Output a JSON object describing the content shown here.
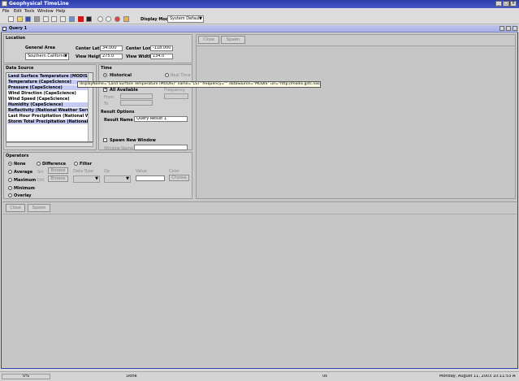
{
  "window": {
    "title": "Geophysical TimeLine",
    "minimize": "_",
    "maximize": "□",
    "close": "X"
  },
  "menu": [
    "File",
    "Edit",
    "Tools",
    "Window",
    "Help"
  ],
  "toolbar": {
    "display_mode_label": "Display Mode",
    "display_mode_value": "System Default"
  },
  "frame": {
    "title": "Query 1"
  },
  "location": {
    "title": "Location",
    "general_area_label": "General Area",
    "general_area_value": "Southern California",
    "center_lat_label": "Center Lat",
    "center_lat_value": "34.000",
    "center_long_label": "Center Long",
    "center_long_value": "-118.000",
    "view_height_label": "View Height",
    "view_height_value": "275.0",
    "view_width_label": "View Width",
    "view_width_value": "134.0"
  },
  "data_source": {
    "title": "Data Source",
    "items": [
      "Land Surface Temperature (MODIS)",
      "Temperature (CapeScience)",
      "Pressure (CapeScience)",
      "Wind Direction (CapeScience)",
      "Wind Speed (CapeScience)",
      "Humidity (CapeScience)",
      "Reflectivity (National Weather Service)",
      "Last Hour Precipitation (National Weather Se",
      "Storm Total Precipitation (National Weather S"
    ],
    "tooltip": "displayName=\"Land Surface Temperature (MODIS)\" name=\"LST\" frequency=\"\" dataSource=\"MODIS\" url=\"http://modis.gsfc.nasa.gov\""
  },
  "time": {
    "title": "Time",
    "historical_label": "Historical",
    "realtime_label": "Real Time",
    "all_available_label": "All Available",
    "frequency_label": "Frequency",
    "from_label": "From",
    "to_label": "To"
  },
  "result_options": {
    "title": "Result Options",
    "result_name_label": "Result Name",
    "result_name_value": "Query Result 1",
    "spawn_new_window_label": "Spawn New Window",
    "window_name_label": "Window Name"
  },
  "operators": {
    "title": "Operators",
    "none_label": "None",
    "difference_label": "Difference",
    "filter_label": "Filter",
    "average_label": "Average",
    "maximum_label": "Maximum",
    "minimum_label": "Minimum",
    "overlay_label": "Overlay",
    "src_label": "Src",
    "dst_label": "Dst",
    "browse_label": "Browse",
    "data_type_label": "Data Type",
    "op_label": "Op",
    "value_label": "Value",
    "color_label": "Color",
    "choose_label": "Choose"
  },
  "buttons": {
    "close": "Close",
    "spawn": "Spawn"
  },
  "status": {
    "progress": "0%",
    "message": "Done",
    "count": "0s",
    "datetime": "Monday, August 11, 2003 10:11:53 AM"
  }
}
